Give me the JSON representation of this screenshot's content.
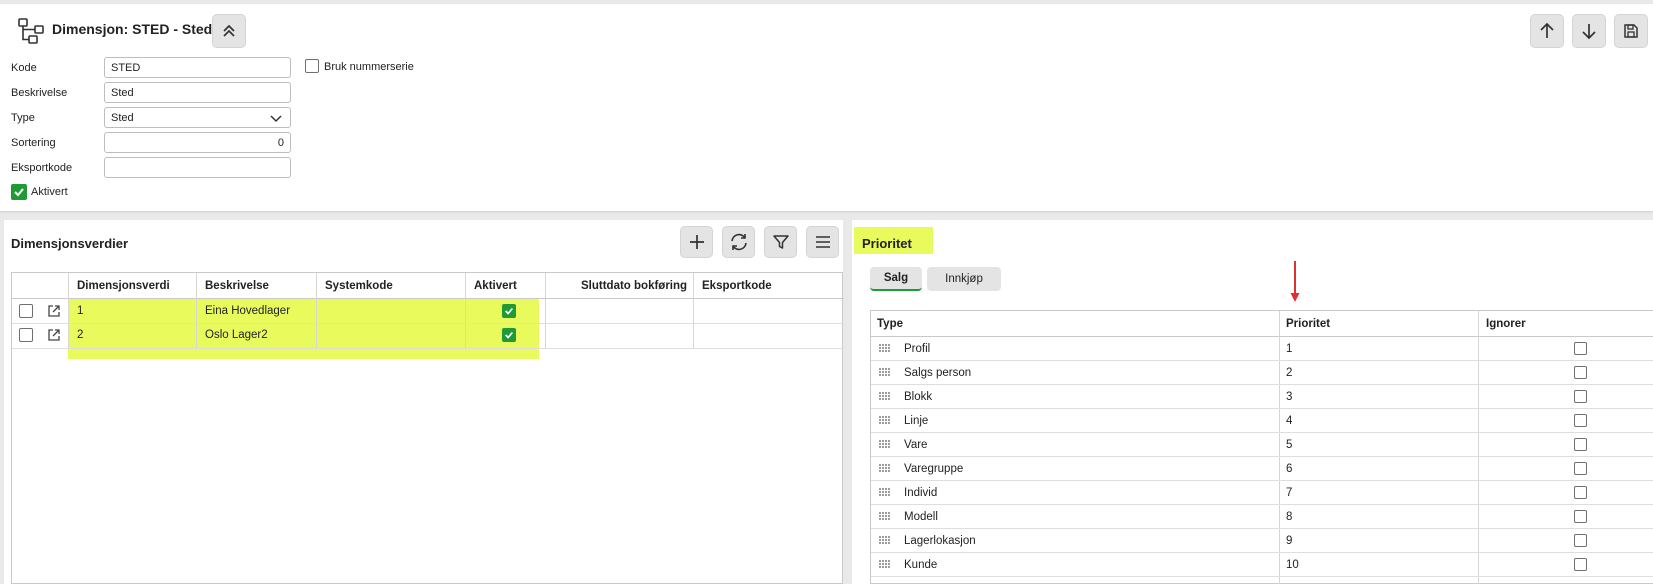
{
  "header": {
    "title": "Dimensjon: STED - Sted",
    "icon": "hierarchy-icon"
  },
  "form": {
    "kode_label": "Kode",
    "kode_value": "STED",
    "beskrivelse_label": "Beskrivelse",
    "beskrivelse_value": "Sted",
    "type_label": "Type",
    "type_value": "Sted",
    "sortering_label": "Sortering",
    "sortering_value": "0",
    "eksportkode_label": "Eksportkode",
    "eksportkode_value": "",
    "aktivert_label": "Aktivert",
    "aktivert_checked": true,
    "nummerserie_label": "Bruk nummerserie",
    "nummerserie_checked": false
  },
  "left_panel": {
    "title": "Dimensjonsverdier",
    "toolbar": [
      "plus-icon",
      "refresh-icon",
      "filter-icon",
      "menu-icon"
    ],
    "columns": [
      "Dimensjonsverdi",
      "Beskrivelse",
      "Systemkode",
      "Aktivert",
      "Sluttdato bokføring",
      "Eksportkode"
    ],
    "rows": [
      {
        "dimensjonsverdi": "1",
        "beskrivelse": "Eina Hovedlager",
        "systemkode": "",
        "aktivert": true,
        "sluttdato": "",
        "eksportkode": ""
      },
      {
        "dimensjonsverdi": "2",
        "beskrivelse": "Oslo Lager2",
        "systemkode": "",
        "aktivert": true,
        "sluttdato": "",
        "eksportkode": ""
      }
    ]
  },
  "right_panel": {
    "title": "Prioritet",
    "tabs": [
      "Salg",
      "Innkjøp"
    ],
    "active_tab": "Salg",
    "columns": [
      "Type",
      "Prioritet",
      "Ignorer"
    ],
    "rows": [
      {
        "type": "Profil",
        "prioritet": "1"
      },
      {
        "type": "Salgs person",
        "prioritet": "2"
      },
      {
        "type": "Blokk",
        "prioritet": "3"
      },
      {
        "type": "Linje",
        "prioritet": "4"
      },
      {
        "type": "Vare",
        "prioritet": "5"
      },
      {
        "type": "Varegruppe",
        "prioritet": "6"
      },
      {
        "type": "Individ",
        "prioritet": "7"
      },
      {
        "type": "Modell",
        "prioritet": "8"
      },
      {
        "type": "Lagerlokasjon",
        "prioritet": "9"
      },
      {
        "type": "Kunde",
        "prioritet": "10"
      }
    ]
  },
  "colors": {
    "highlight": "#e9fa5c",
    "checkbox_green": "#1f9a35",
    "tab_underline": "#1f9a35",
    "arrow": "#e03030"
  }
}
